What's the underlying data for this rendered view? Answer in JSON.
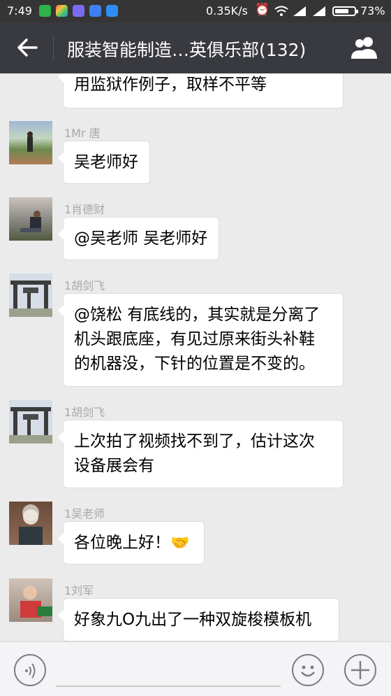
{
  "status_bar": {
    "time": "7:49",
    "network_speed": "0.35K/s",
    "battery_percent": "73%",
    "battery_level": 0.73
  },
  "header": {
    "title": "服装智能制造…英俱乐部(132)",
    "back_icon": "arrow-left-icon",
    "members_icon": "group-members-icon"
  },
  "messages": [
    {
      "sender": "",
      "text": "用监狱作例子，取样不平等"
    },
    {
      "sender": "1Mr 唐",
      "text": "吴老师好"
    },
    {
      "sender": "1肖德财",
      "text": "@吴老师 吴老师好"
    },
    {
      "sender": "1胡剑飞",
      "text": "@饶松 有底线的，其实就是分离了\n机头跟底座，有见过原来街头补鞋\n的机器没，下针的位置是不变的。"
    },
    {
      "sender": "1胡剑飞",
      "text": "上次拍了视频找不到了，估计这次\n设备展会有"
    },
    {
      "sender": "1吴老师",
      "text": "各位晚上好！",
      "emoji": "handshake-icon"
    },
    {
      "sender": "1刘军",
      "text": "好象九O九出了一种双旋梭模板机"
    }
  ],
  "input_bar": {
    "voice_icon": "voice-icon",
    "emoji_icon": "smiley-icon",
    "more_icon": "plus-icon"
  },
  "colors": {
    "status_bar": "#353535",
    "title_bar": "#393a3f",
    "chat_bg": "#ebebeb",
    "bubble": "#ffffff"
  }
}
